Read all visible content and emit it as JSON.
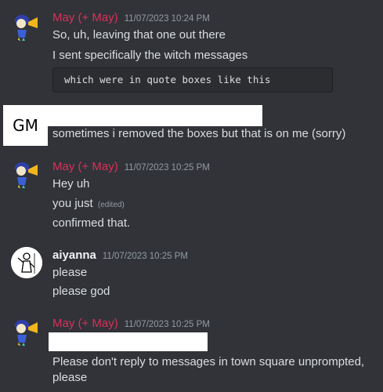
{
  "messages": [
    {
      "author": "May (+ May)",
      "timestamp": "11/07/2023 10:24 PM",
      "lines": [
        "So, uh, leaving that one out there",
        "I sent specifically the witch messages"
      ],
      "code_block": "which were in quote boxes like this"
    },
    {
      "author_label": "GM",
      "lines": [
        "sometimes i removed the boxes but that is on me (sorry)"
      ]
    },
    {
      "author": "May (+ May)",
      "timestamp": "11/07/2023 10:25 PM",
      "lines": [
        "Hey uh",
        "you just",
        "confirmed that."
      ],
      "edited_label": "(edited)"
    },
    {
      "author": "aiyanna",
      "timestamp": "11/07/2023 10:25 PM",
      "lines": [
        "please",
        "please god"
      ]
    },
    {
      "author": "May (+ May)",
      "timestamp": "11/07/2023 10:25 PM",
      "lines": [
        "Please don't reply to messages in town square unprompted,",
        "please"
      ]
    }
  ],
  "colors": {
    "background": "#313338",
    "may_name": "#d8315b",
    "text": "#dbdee1",
    "timestamp": "#949ba4"
  }
}
